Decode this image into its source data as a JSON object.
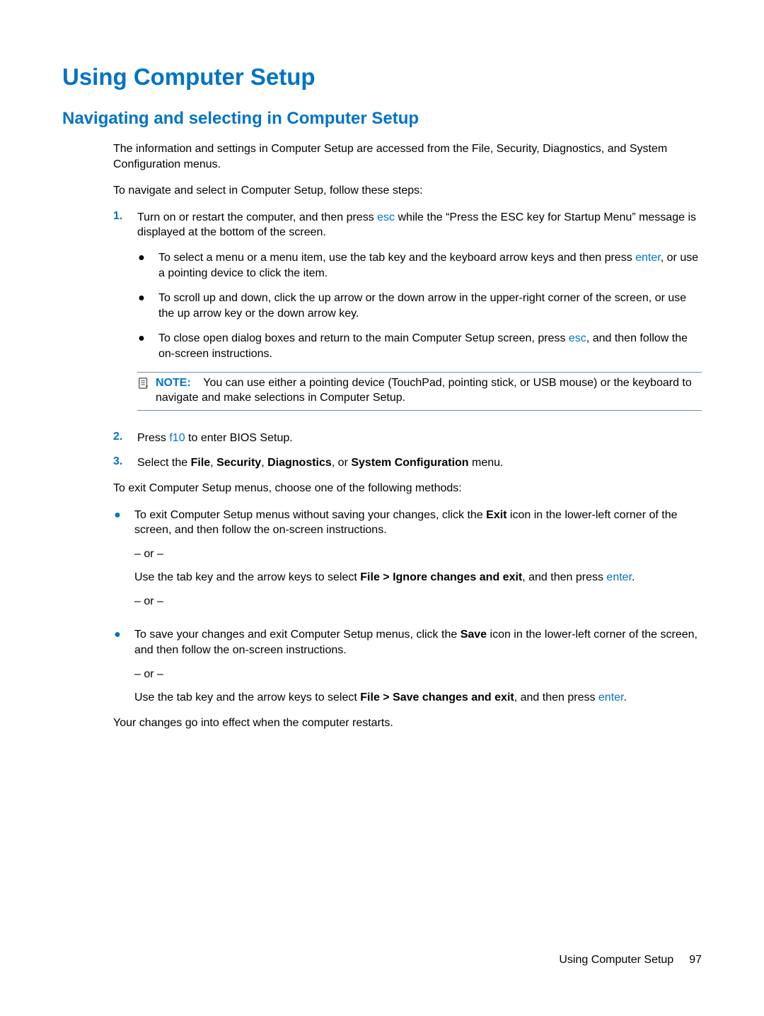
{
  "h1": "Using Computer Setup",
  "h2": "Navigating and selecting in Computer Setup",
  "intro": "The information and settings in Computer Setup are accessed from the File, Security, Diagnostics, and System Configuration menus.",
  "lead": "To navigate and select in Computer Setup, follow these steps:",
  "steps": {
    "s1": {
      "num": "1.",
      "t1": "Turn on or restart the computer, and then press ",
      "key1": "esc",
      "t2": " while the “Press the ESC key for Startup Menu” message is displayed at the bottom of the screen.",
      "bullets": {
        "b1a": "To select a menu or a menu item, use the tab key and the keyboard arrow keys and then press ",
        "b1key": "enter",
        "b1b": ", or use a pointing device to click the item.",
        "b2": "To scroll up and down, click the up arrow or the down arrow in the upper-right corner of the screen, or use the up arrow key or the down arrow key.",
        "b3a": "To close open dialog boxes and return to the main Computer Setup screen, press ",
        "b3key": "esc",
        "b3b": ", and then follow the on-screen instructions."
      },
      "note": {
        "label": "NOTE:",
        "text": "You can use either a pointing device (TouchPad, pointing stick, or USB mouse) or the keyboard to navigate and make selections in Computer Setup."
      }
    },
    "s2": {
      "num": "2.",
      "t1": "Press ",
      "key": "f10",
      "t2": " to enter BIOS Setup."
    },
    "s3": {
      "num": "3.",
      "t1": "Select the ",
      "m1": "File",
      "c1": ", ",
      "m2": "Security",
      "c2": ", ",
      "m3": "Diagnostics",
      "c3": ", or ",
      "m4": "System Configuration",
      "t2": " menu."
    }
  },
  "exitIntro": "To exit Computer Setup menus, choose one of the following methods:",
  "exit": {
    "e1a": "To exit Computer Setup menus without saving your changes, click the ",
    "e1b": "Exit",
    "e1c": " icon in the lower-left corner of the screen, and then follow the on-screen instructions.",
    "or": "– or –",
    "e1d": "Use the tab key and the arrow keys to select ",
    "e1e": "File > Ignore changes and exit",
    "e1f": ", and then press ",
    "e1key": "enter",
    "e1g": ".",
    "e2a": "To save your changes and exit Computer Setup menus, click the ",
    "e2b": "Save",
    "e2c": " icon in the lower-left corner of the screen, and then follow the on-screen instructions.",
    "e2d": "Use the tab key and the arrow keys to select ",
    "e2e": "File > Save changes and exit",
    "e2f": ", and then press ",
    "e2key": "enter",
    "e2g": "."
  },
  "closing": "Your changes go into effect when the computer restarts.",
  "footer": {
    "section": "Using Computer Setup",
    "page": "97"
  }
}
